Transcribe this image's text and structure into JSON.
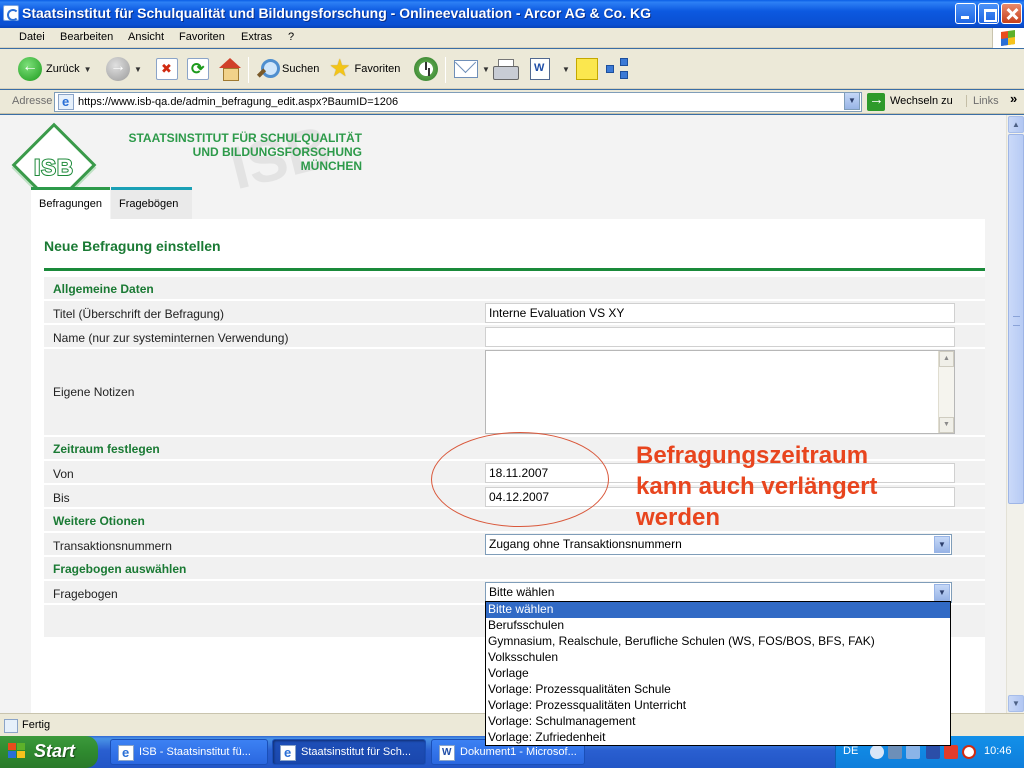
{
  "window": {
    "title": "Staatsinstitut für Schulqualität und Bildungsforschung - Onlineevaluation - Arcor AG & Co. KG"
  },
  "menubar": {
    "items": [
      "Datei",
      "Bearbeiten",
      "Ansicht",
      "Favoriten",
      "Extras",
      "?"
    ]
  },
  "toolbar": {
    "back_label": "Zurück",
    "search_label": "Suchen",
    "favorites_label": "Favoriten"
  },
  "address": {
    "label": "Adresse",
    "url": "https://www.isb-qa.de/admin_befragung_edit.aspx?BaumID=1206",
    "go_label": "Wechseln zu",
    "links_label": "Links"
  },
  "site": {
    "logo_text": "ISB",
    "institute_lines": [
      "STAATSINSTITUT FÜR SCHULQUALITÄT",
      "UND BILDUNGSFORSCHUNG",
      "MÜNCHEN"
    ],
    "tabs": [
      "Befragungen",
      "Fragebögen"
    ]
  },
  "form": {
    "title": "Neue Befragung einstellen",
    "sections": {
      "general": "Allgemeine Daten",
      "period": "Zeitraum festlegen",
      "options": "Weitere Otionen",
      "questionnaire": "Fragebogen auswählen"
    },
    "fields": {
      "title_label": "Titel (Überschrift der Befragung)",
      "title_value": "Interne Evaluation VS XY",
      "name_label": "Name (nur zur systeminternen Verwendung)",
      "name_value": "",
      "notes_label": "Eigene Notizen",
      "from_label": "Von",
      "from_value": "18.11.2007",
      "to_label": "Bis",
      "to_value": "04.12.2007",
      "tan_label": "Transaktionsnummern",
      "tan_value": "Zugang ohne Transaktionsnummern",
      "questionnaire_label": "Fragebogen",
      "questionnaire_value": "Bitte wählen"
    },
    "questionnaire_options": [
      "Bitte wählen",
      "Berufsschulen",
      "Gymnasium, Realschule, Berufliche Schulen (WS, FOS/BOS, BFS, FAK)",
      "Volksschulen",
      "Vorlage",
      "Vorlage: Prozessqualitäten Schule",
      "Vorlage: Prozessqualitäten Unterricht",
      "Vorlage: Schulmanagement",
      "Vorlage: Zufriedenheit"
    ]
  },
  "annotation": {
    "lines": [
      "Befragungszeitraum",
      "kann auch verlängert",
      "werden"
    ],
    "color": "#e8451e"
  },
  "statusbar": {
    "text": "Fertig"
  },
  "taskbar": {
    "start_label": "Start",
    "tasks": [
      "ISB - Staatsinstitut fü...",
      "Staatsinstitut für Sch...",
      "Dokument1 - Microsof..."
    ],
    "language": "DE",
    "clock": "10:46"
  },
  "colors": {
    "brand_green": "#2d9a4a",
    "section_green": "#1a7a34",
    "selection_blue": "#316ac5"
  }
}
